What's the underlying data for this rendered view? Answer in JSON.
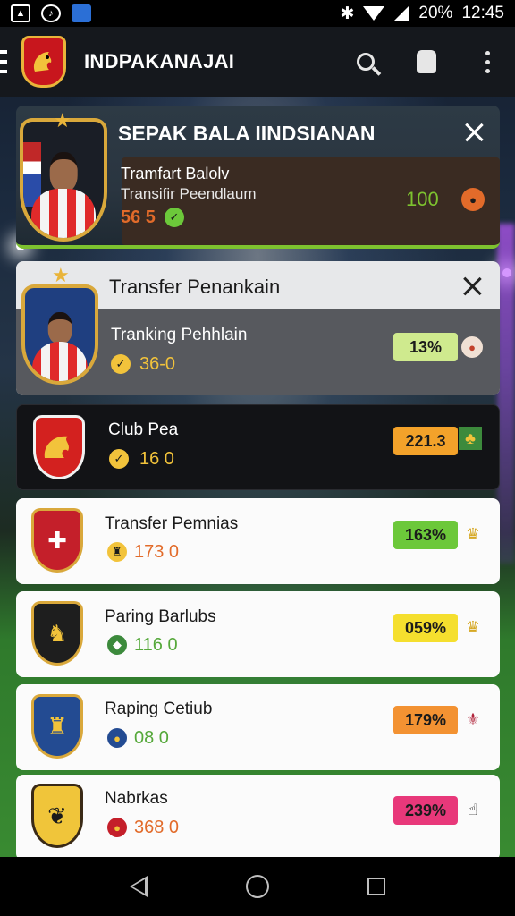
{
  "status_bar": {
    "battery": "20%",
    "time": "12:45"
  },
  "app_bar": {
    "title": "INDPAKANAJAI"
  },
  "featured": {
    "title": "SEPAK BALA IINDSIANAN",
    "line1": "Tramfart Balolv",
    "line2": "Transifir Peendlaum",
    "stat": "56 5",
    "value": "100"
  },
  "transfer_card": {
    "title": "Transfer Penankain",
    "name": "Tranking Pehhlain",
    "stat": "36-0",
    "percent": "13%"
  },
  "club_list": [
    {
      "name": "Club Pea",
      "stat": "16 0",
      "badge": "221.3",
      "badge_color": "#f3a22a",
      "stat_color": "#e0e0e0",
      "icon": "green-flag-icon",
      "crest_bg": "#d3211f"
    },
    {
      "name": "Transfer Pemnias",
      "stat": "173 0",
      "badge": "163%",
      "badge_color": "#6cc83a",
      "stat_color": "#e26b2a",
      "icon": "yellow-trophy-icon",
      "crest_bg": "#c41f2a"
    },
    {
      "name": "Paring Barlubs",
      "stat": "116 0",
      "badge": "059%",
      "badge_color": "#f5df2e",
      "stat_color": "#55a83a",
      "icon": "yellow-trophy-icon",
      "crest_bg": "#1e1e1e"
    },
    {
      "name": "Raping Cetiub",
      "stat": "08 0",
      "badge": "179%",
      "badge_color": "#f39232",
      "stat_color": "#55a83a",
      "icon": "red-shield-icon",
      "crest_bg": "#234b92"
    },
    {
      "name": "Nabrkas",
      "stat": "368 0",
      "badge": "239%",
      "badge_color": "#e8387a",
      "stat_color": "#e26b2a",
      "icon": "hand-icon",
      "crest_bg": "#f0c53a"
    }
  ]
}
